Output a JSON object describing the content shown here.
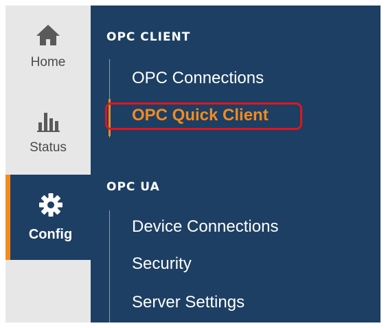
{
  "rail": {
    "home_label": "Home",
    "status_label": "Status",
    "config_label": "Config"
  },
  "sections": {
    "opc_client": {
      "title": "OPC CLIENT",
      "links": [
        "OPC Connections",
        "OPC Quick Client"
      ]
    },
    "opc_ua": {
      "title": "OPC UA",
      "links": [
        "Device Connections",
        "Security",
        "Server Settings"
      ]
    }
  },
  "active_item": "OPC Quick Client",
  "icons": [
    "home-icon",
    "bar-chart-icon",
    "gear-icon"
  ],
  "colors": {
    "panel": "#1d3f63",
    "rail": "#e7e7e7",
    "accent": "#f58a1f",
    "highlight": "#e3141e"
  }
}
